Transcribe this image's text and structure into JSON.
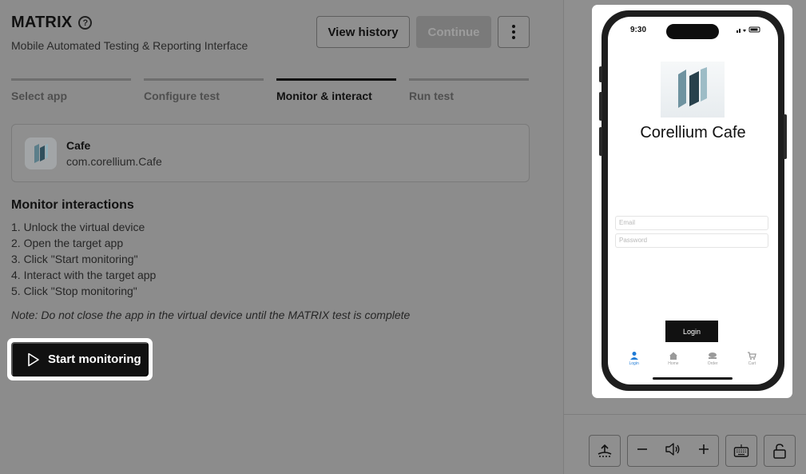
{
  "header": {
    "title": "MATRIX",
    "subtitle": "Mobile Automated Testing & Reporting Interface",
    "view_history_label": "View history",
    "continue_label": "Continue"
  },
  "steps": [
    {
      "label": "Select app",
      "active": false
    },
    {
      "label": "Configure test",
      "active": false
    },
    {
      "label": "Monitor & interact",
      "active": true
    },
    {
      "label": "Run test",
      "active": false
    }
  ],
  "app": {
    "name": "Cafe",
    "bundle_id": "com.corellium.Cafe"
  },
  "monitor": {
    "title": "Monitor interactions",
    "instructions": [
      "1. Unlock the virtual device",
      "2. Open the target app",
      "3. Click \"Start monitoring\"",
      "4. Interact with the target app",
      "5. Click \"Stop monitoring\""
    ],
    "note": "Note: Do not close the app in the virtual device until the MATRIX test is complete",
    "start_label": "Start monitoring"
  },
  "device": {
    "time": "9:30",
    "app_title": "Corellium Cafe",
    "email_placeholder": "Email",
    "password_placeholder": "Password",
    "login_label": "Login",
    "tabs": [
      "Login",
      "Home",
      "Order",
      "Cart"
    ],
    "active_tab": "Login"
  },
  "controls": [
    "screenshot-icon",
    "volume-down-icon",
    "volume-icon",
    "volume-up-icon",
    "keyboard-icon",
    "unlock-icon"
  ],
  "colors": {
    "accent": "#111111",
    "active_tab": "#1f7bd6",
    "overlay": "#8c8c8c"
  }
}
